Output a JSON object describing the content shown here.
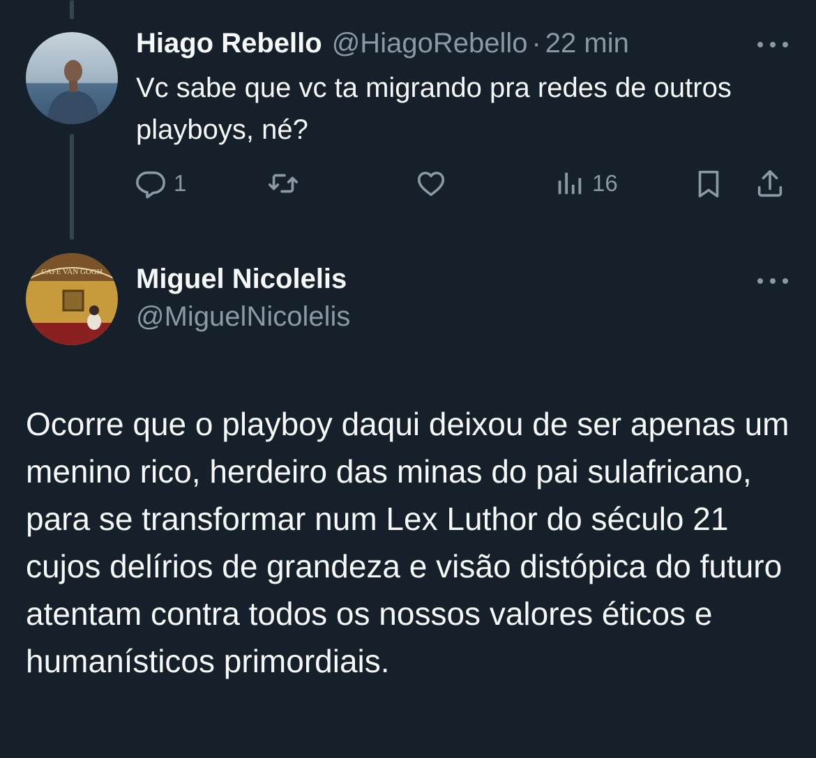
{
  "reply": {
    "author_name": "Hiago Rebello",
    "handle": "@HiagoRebello",
    "separator": "·",
    "time": "22 min",
    "text": "Vc sabe que vc ta migrando pra redes de outros playboys, né?",
    "avatar_icon": "user-avatar-photo",
    "actions": {
      "reply_icon": "reply-icon",
      "reply_count": "1",
      "retweet_icon": "retweet-icon",
      "like_icon": "heart-icon",
      "views_icon": "views-bar-chart-icon",
      "views_count": "16",
      "bookmark_icon": "bookmark-icon",
      "share_icon": "share-icon"
    }
  },
  "main": {
    "author_name": "Miguel Nicolelis",
    "handle": "@MiguelNicolelis",
    "avatar_icon": "user-avatar-photo",
    "avatar_sign_text": "CAFÉ VAN GOGH",
    "text": "Ocorre que o playboy daqui deixou de ser apenas um menino rico, herdeiro das minas do pai sulafricano, para se transformar num Lex Luthor do século 21 cujos delírios de grandeza e visão distópica do futuro atentam contra todos os nossos valores éticos e humanísticos primordiais."
  },
  "theme": {
    "background": "#15202b",
    "primary_text": "#f7f9f9",
    "secondary_text": "#8b98a5",
    "thread_line": "#38444d"
  }
}
